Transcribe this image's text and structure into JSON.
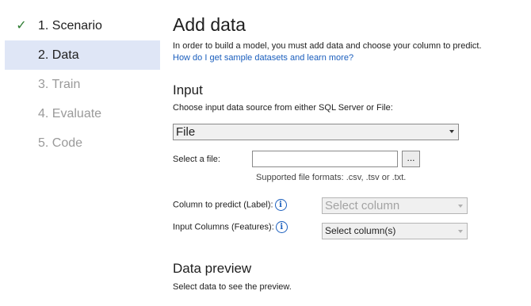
{
  "steps": [
    {
      "label": "1. Scenario",
      "state": "done"
    },
    {
      "label": "2. Data",
      "state": "active"
    },
    {
      "label": "3. Train",
      "state": "pending"
    },
    {
      "label": "4. Evaluate",
      "state": "pending"
    },
    {
      "label": "5. Code",
      "state": "pending"
    }
  ],
  "check_glyph": "✓",
  "page": {
    "title": "Add data",
    "intro": "In order to build a model, you must add data and choose your column to predict.",
    "help_link": "How do I get sample datasets and learn more?"
  },
  "input": {
    "heading": "Input",
    "instruction": "Choose input data source from either SQL Server or File:",
    "source_selected": "File",
    "file_label": "Select a file:",
    "file_value": "",
    "browse_label": "...",
    "formats": "Supported file formats: .csv, .tsv or .txt.",
    "label_column_label": "Column to predict (Label):",
    "label_column_value": "Select column",
    "feature_columns_label": "Input Columns (Features):",
    "feature_columns_value": "Select column(s)",
    "info_glyph": "i"
  },
  "preview": {
    "heading": "Data preview",
    "text": "Select data to see the preview."
  },
  "colors": {
    "accent": "#1a5ebd",
    "active_step_bg": "#dfe6f6",
    "check": "#2e7d32"
  }
}
